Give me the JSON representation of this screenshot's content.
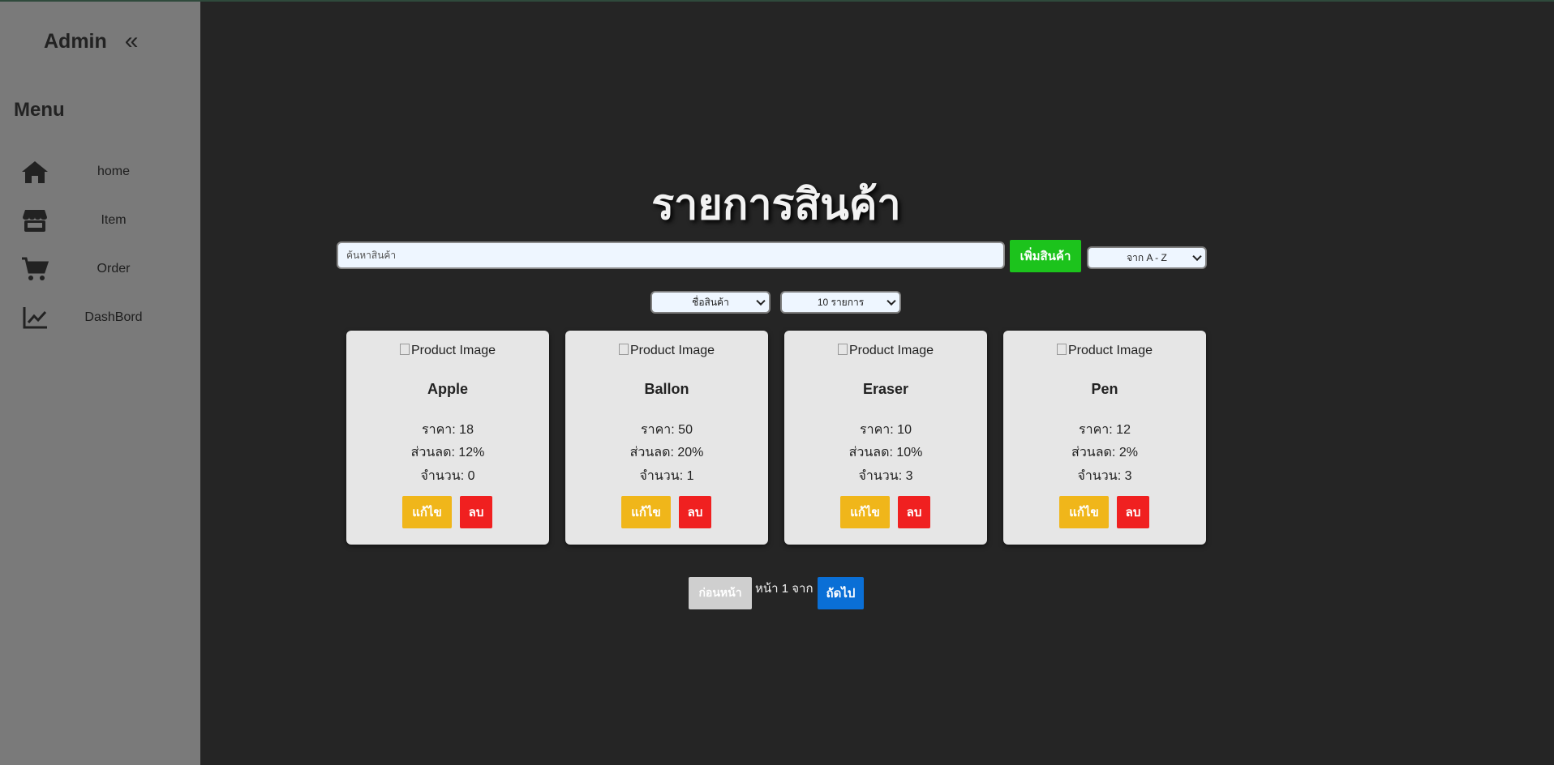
{
  "sidebar": {
    "title": "Admin",
    "collapse_icon": "«",
    "menu_title": "Menu",
    "items": [
      {
        "label": "home",
        "icon": "home-icon"
      },
      {
        "label": "Item",
        "icon": "store-icon"
      },
      {
        "label": "Order",
        "icon": "cart-icon"
      },
      {
        "label": "DashBord",
        "icon": "chart-line-icon"
      }
    ]
  },
  "main": {
    "title": "รายการสินค้า",
    "search_placeholder": "ค้นหาสินค้า",
    "add_button": "เพิ่มสินค้า",
    "sort_select": "จาก A - Z",
    "field_select": "ชื่อสินค้า",
    "per_page_select": "10 รายการ",
    "image_alt": "Product Image",
    "edit_label": "แก้ไข",
    "delete_label": "ลบ",
    "products": [
      {
        "name": "Apple",
        "price": "ราคา: 18",
        "discount": "ส่วนลด: 12%",
        "quantity": "จำนวน: 0"
      },
      {
        "name": "Ballon",
        "price": "ราคา: 50",
        "discount": "ส่วนลด: 20%",
        "quantity": "จำนวน: 1"
      },
      {
        "name": "Eraser",
        "price": "ราคา: 10",
        "discount": "ส่วนลด: 10%",
        "quantity": "จำนวน: 3"
      },
      {
        "name": "Pen",
        "price": "ราคา: 12",
        "discount": "ส่วนลด: 2%",
        "quantity": "จำนวน: 3"
      }
    ],
    "pagination": {
      "prev": "ก่อนหน้า",
      "info": "หน้า 1 จาก",
      "next": "ถัดไป"
    }
  },
  "colors": {
    "background": "#252525",
    "sidebar": "#7a7a7a",
    "card": "#e6e6e6",
    "add_button": "#1cc31c",
    "edit_button": "#f0b61a",
    "delete_button": "#f02020",
    "next_button": "#0a6fd6",
    "prev_button": "#cfcfcf"
  }
}
